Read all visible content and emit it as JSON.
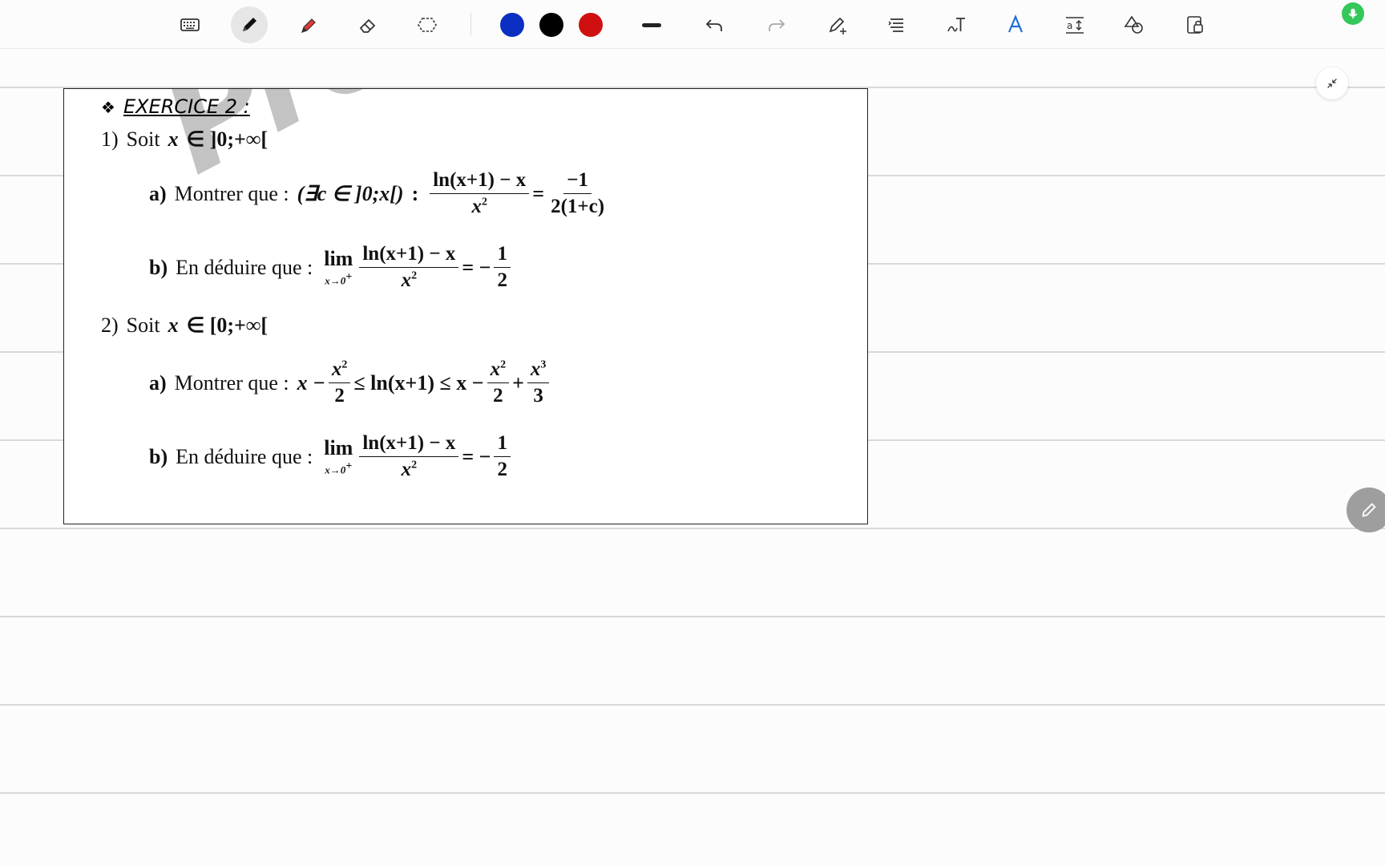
{
  "toolbar": {
    "tools": [
      {
        "name": "keyboard-icon"
      },
      {
        "name": "pen-icon"
      },
      {
        "name": "highlighter-icon"
      },
      {
        "name": "eraser-icon"
      },
      {
        "name": "lasso-icon"
      }
    ],
    "colors": [
      "#0a2fc2",
      "#000000",
      "#d01010"
    ],
    "actions": [
      "stroke-width-icon",
      "undo-icon",
      "redo-icon",
      "pen-settings-icon",
      "align-icon",
      "handwriting-icon",
      "text-style-icon",
      "text-size-icon",
      "shapes-icon",
      "lock-icon"
    ]
  },
  "exercise": {
    "bullet": "❖",
    "title": "EXERCICE 2 :",
    "watermark": "Prof",
    "q1": {
      "num": "1)",
      "text": "Soit",
      "cond_var": "x",
      "cond": "∈ ]0;+∞[",
      "a_label": "a)",
      "a_text": "Montrer que :",
      "a_exists": "(∃c ∈ ]0;x[)",
      "a_colon": ":",
      "a_num": "ln(x+1) − x",
      "a_den": "x",
      "a_den_exp": "2",
      "a_eq": "=",
      "a_rhs_num": "−1",
      "a_rhs_den": "2(1+c)",
      "b_label": "b)",
      "b_text": "En déduire que :",
      "b_lim": "lim",
      "b_lim_sub": "x→0",
      "b_lim_sub_sup": "+",
      "b_num": "ln(x+1) − x",
      "b_den": "x",
      "b_den_exp": "2",
      "b_eq": "= −",
      "b_rhs_num": "1",
      "b_rhs_den": "2"
    },
    "q2": {
      "num": "2)",
      "text": "Soit",
      "cond_var": "x",
      "cond": "∈ [0;+∞[",
      "a_label": "a)",
      "a_text": "Montrer que :",
      "a_x1": "x −",
      "a_f1_num": "x",
      "a_f1_num_exp": "2",
      "a_f1_den": "2",
      "a_mid": "≤ ln(x+1) ≤ x −",
      "a_f2_num": "x",
      "a_f2_num_exp": "2",
      "a_f2_den": "2",
      "a_plus": "+",
      "a_f3_num": "x",
      "a_f3_num_exp": "3",
      "a_f3_den": "3",
      "b_label": "b)",
      "b_text": "En déduire que :",
      "b_lim": "lim",
      "b_lim_sub": "x→0",
      "b_lim_sub_sup": "+",
      "b_num": "ln(x+1) − x",
      "b_den": "x",
      "b_den_exp": "2",
      "b_eq": "= −",
      "b_rhs_num": "1",
      "b_rhs_den": "2"
    }
  }
}
